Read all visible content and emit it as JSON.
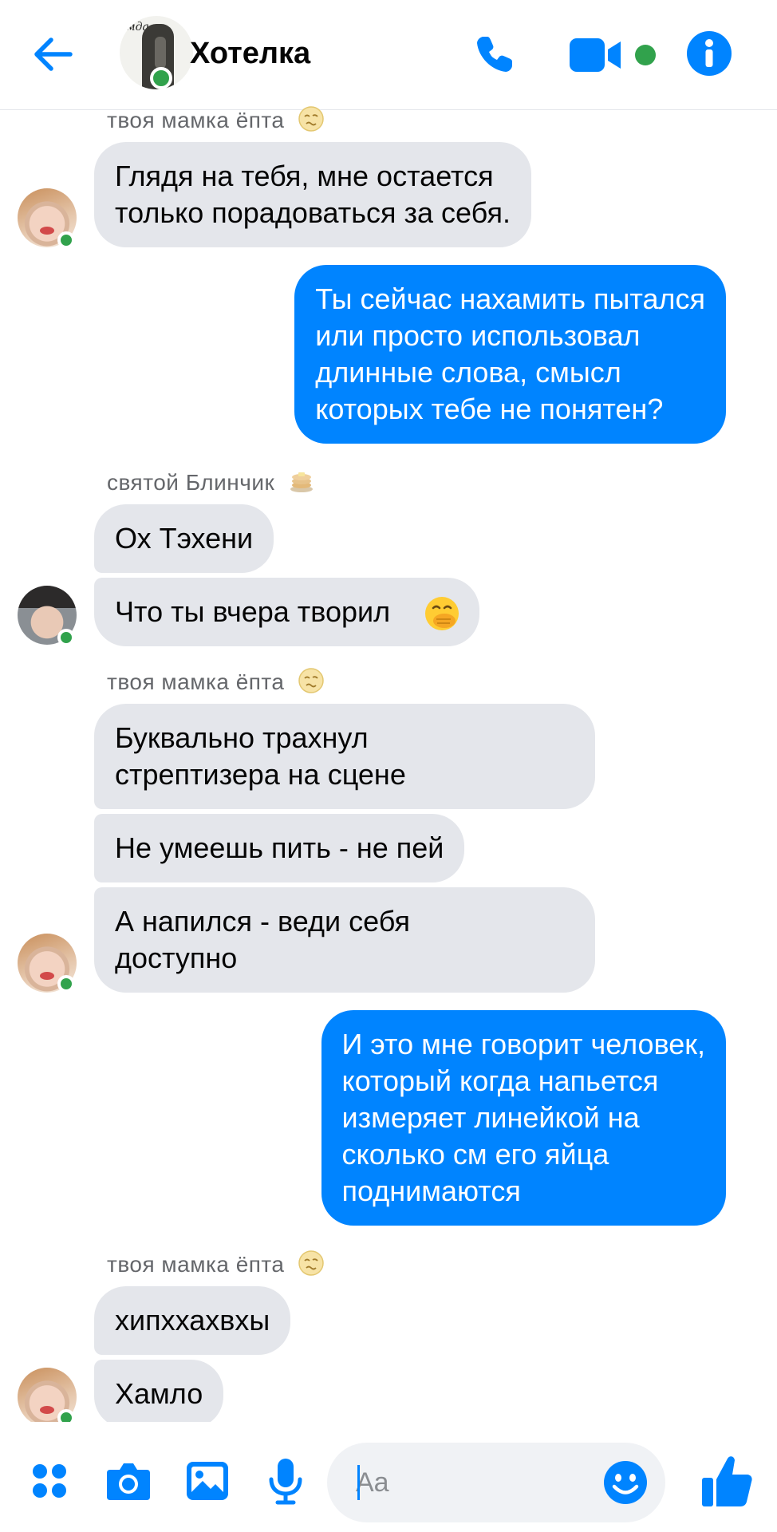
{
  "header": {
    "title": "Хотелка",
    "avatar_caption": "мда",
    "icons": [
      "back-arrow-icon",
      "phone-icon",
      "video-camera-icon",
      "info-icon"
    ]
  },
  "messages": {
    "g1_sender": "твоя мамка ёпта",
    "m1_l1": "Глядя на тебя, мне остается",
    "m1_l2": "только порадоваться за себя.",
    "m2_l1": "Ты сейчас нахамить пытался",
    "m2_l2": "или просто использовал",
    "m2_l3": "длинные слова, смысл",
    "m2_l4": "которых тебе не понятен?",
    "g2_sender": "святой Блинчик",
    "m3": "Ох Тэхени",
    "m4": "Что ты вчера творил",
    "g3_sender": "твоя мамка ёпта",
    "m5_l1": "Буквально трахнул",
    "m5_l2": "стрептизера на сцене",
    "m6": "Не умеешь пить - не пей",
    "m7_l1": "А напился - веди себя",
    "m7_l2": "доступно",
    "m8_l1": "И это мне говорит человек,",
    "m8_l2": "который когда напьется",
    "m8_l3": "измеряет линейкой на",
    "m8_l4": "сколько см его яйца",
    "m8_l5": "поднимаются",
    "g4_sender": "твоя мамка ёпта",
    "m9": "хипххахвхы",
    "m10": "Хамло"
  },
  "composer": {
    "placeholder": "Aa",
    "icons": [
      "menu-dots-icon",
      "camera-icon",
      "gallery-icon",
      "microphone-icon",
      "emoji-icon",
      "thumbs-up-icon"
    ]
  },
  "colors": {
    "accent": "#0084ff",
    "incoming_bubble": "#e4e6eb",
    "online": "#31a24c",
    "secondary_text": "#65676b"
  }
}
